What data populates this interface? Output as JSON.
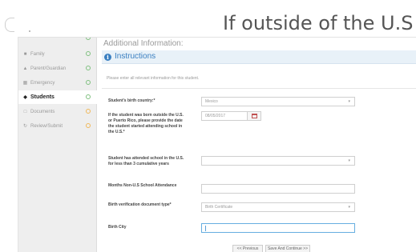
{
  "slide": {
    "title": "If outside of the U.S"
  },
  "sidebar": {
    "items": [
      {
        "label": "Family",
        "status": "complete",
        "icon": "group-icon"
      },
      {
        "label": "Parent/Guardian",
        "status": "complete",
        "icon": "person-icon"
      },
      {
        "label": "Emergency",
        "status": "complete",
        "icon": "medical-icon"
      },
      {
        "label": "Students",
        "status": "complete",
        "icon": "graduation-cap-icon"
      },
      {
        "label": "Documents",
        "status": "pending",
        "icon": "document-icon"
      },
      {
        "label": "Review/Submit",
        "status": "pending",
        "icon": "refresh-icon"
      }
    ]
  },
  "main": {
    "section_title": "Additional Information:",
    "instructions": {
      "title": "Instructions",
      "text": "Please enter all relevant information for this student."
    },
    "fields": {
      "birth_country": {
        "label": "Student's birth country:*",
        "value": "Mexico"
      },
      "start_date": {
        "label": "If the student was born outside the U.S. or Puerto Rico, please provide the date the student started attending school in the U.S.*",
        "value": "08/05/2017"
      },
      "less_than_3": {
        "label": "Student has attended school in the U.S. for less than 3 cumulative years",
        "value": ""
      },
      "months_non_us": {
        "label": "Months Non-U.S School Attendance",
        "value": ""
      },
      "birth_doc": {
        "label": "Birth verification document type*",
        "value": "Birth Certificate"
      },
      "birth_city": {
        "label": "Birth City",
        "value": ""
      }
    },
    "buttons": {
      "previous": "<< Previous",
      "save_continue": "Save And Continue >>"
    }
  },
  "colors": {
    "accent": "#3a7fc1",
    "complete": "#7fc07f",
    "pending": "#f0b85a"
  }
}
